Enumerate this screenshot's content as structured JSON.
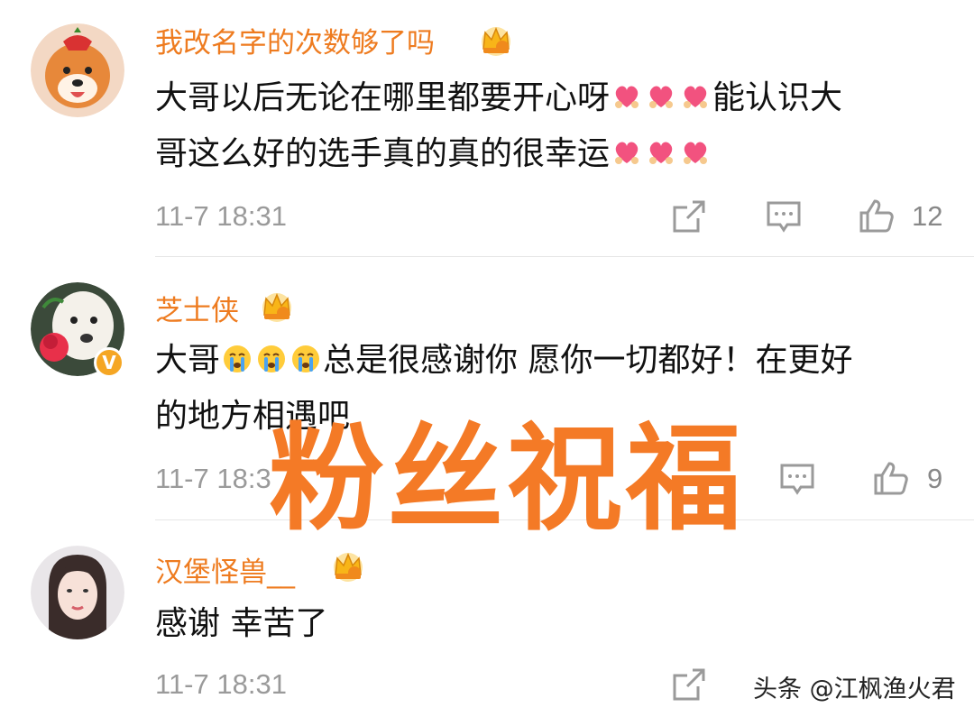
{
  "comments": [
    {
      "username": "我改名字的次数够了吗",
      "text_line1": "大哥以后无论在哪里都要开心呀",
      "text_line1_tail": "能认识大",
      "text_line2": "哥这么好的选手真的真的很幸运",
      "time": "11-7 18:31",
      "likes": "12"
    },
    {
      "username": "芝士侠",
      "text_line1_head": "大哥",
      "text_line1": "总是很感谢你 愿你一切都好！在更好",
      "text_line2": "的地方相遇吧",
      "time": "11-7 18:3",
      "likes": "9"
    },
    {
      "username": "汉堡怪兽__",
      "text_line1": "感谢 幸苦了",
      "time": "11-7 18:31"
    }
  ],
  "overlay_text": "粉丝祝福",
  "watermark": "头条 @江枫渔火君",
  "colors": {
    "username": "#ee7b1f",
    "overlay": "#f47a26",
    "time": "#9a9a9a"
  },
  "icons": [
    "crown-icon",
    "heart-hug-emoji",
    "crying-emoji",
    "share-icon",
    "comment-icon",
    "like-icon",
    "verified-badge"
  ]
}
